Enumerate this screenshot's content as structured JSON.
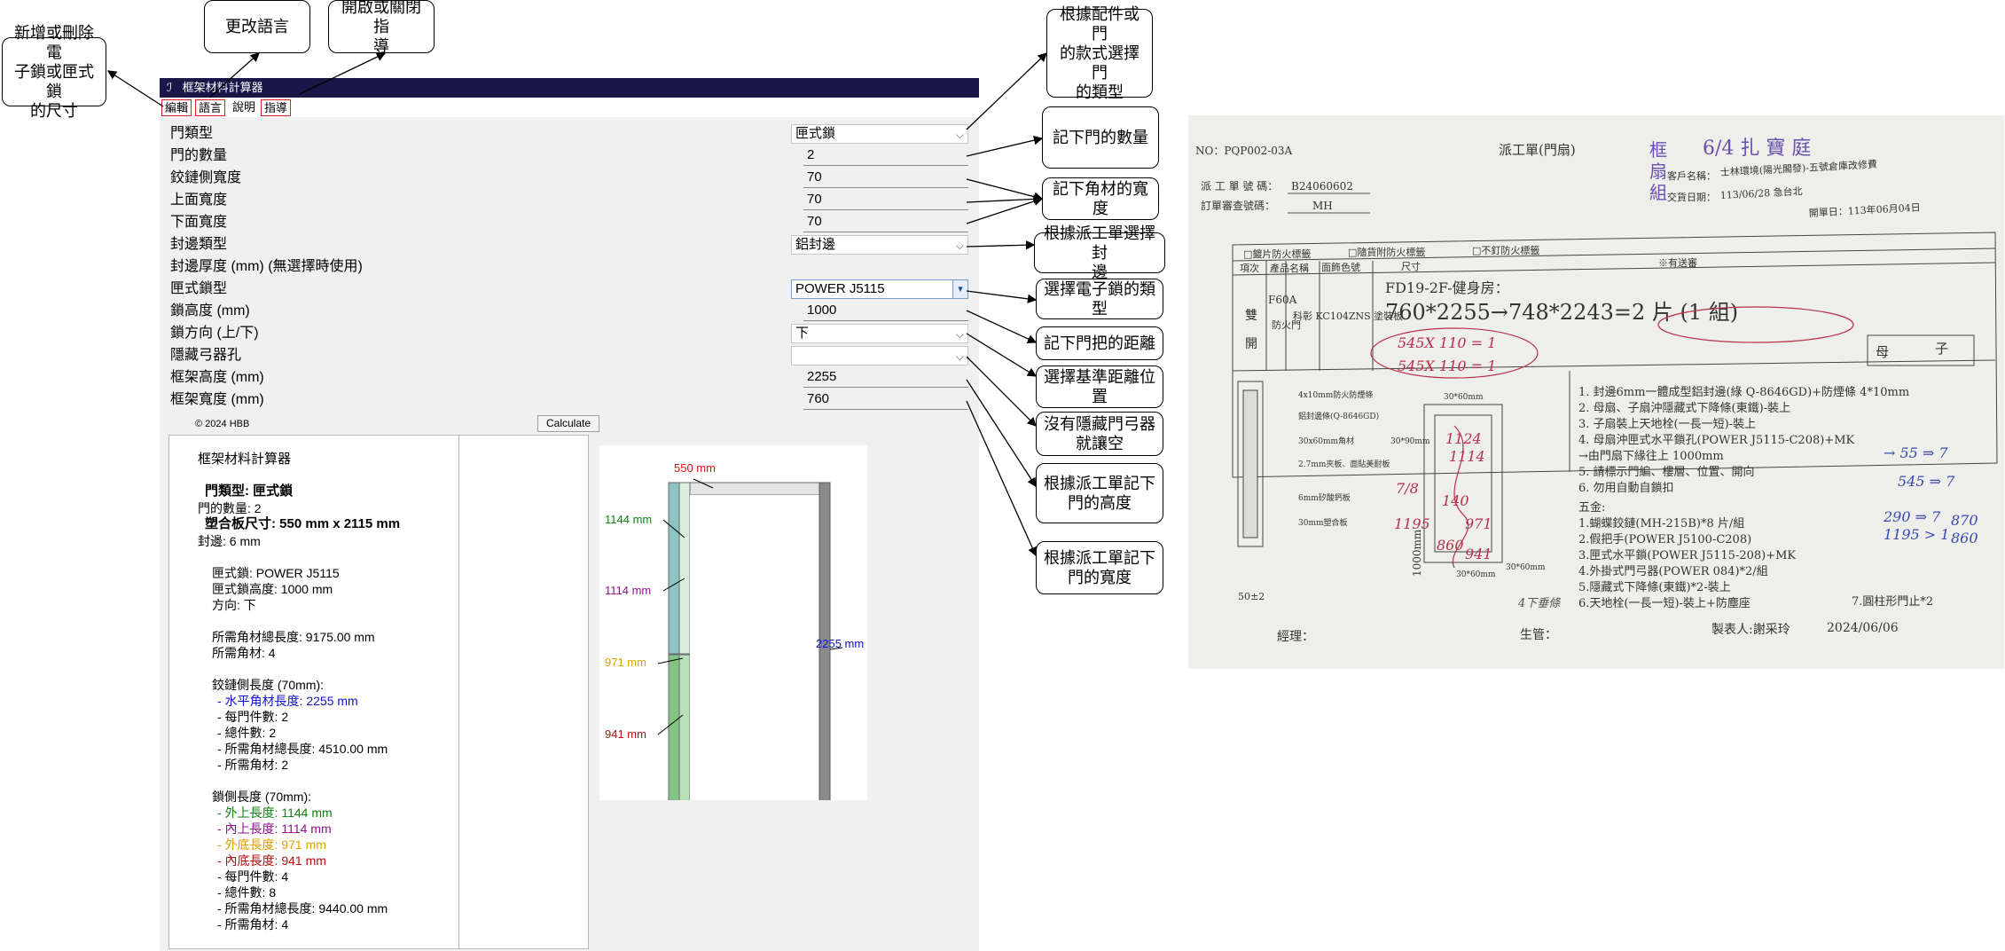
{
  "window": {
    "title": "框架材料計算器"
  },
  "menu": {
    "items": [
      "編輯",
      "語言",
      "說明",
      "指導"
    ]
  },
  "form": {
    "door_type_label": "門類型",
    "door_type_value": "匣式鎖",
    "door_count_label": "門的數量",
    "door_count_value": "2",
    "hinge_width_label": "鉸鏈側寬度",
    "hinge_width_value": "70",
    "top_width_label": "上面寬度",
    "top_width_value": "70",
    "bottom_width_label": "下面寬度",
    "bottom_width_value": "70",
    "edge_type_label": "封邊類型",
    "edge_type_value": "鋁封邊",
    "edge_thickness_label": "封邊厚度 (mm) (無選擇時使用)",
    "lock_type_label": "匣式鎖型",
    "lock_type_value": "POWER J5115",
    "lock_height_label": "鎖高度 (mm)",
    "lock_height_value": "1000",
    "lock_direction_label": "鎖方向 (上/下)",
    "lock_direction_value": "下",
    "hidden_closer_label": "隱藏弓器孔",
    "hidden_closer_value": "",
    "frame_height_label": "框架高度 (mm)",
    "frame_height_value": "2255",
    "frame_width_label": "框架寬度 (mm)",
    "frame_width_value": "760"
  },
  "footer": {
    "copyright": "© 2024 HBB",
    "calculate": "Calculate"
  },
  "result": {
    "title": "框架材料計算器",
    "door_type": "門類型: 匣式鎖",
    "door_count": "門的數量: 2",
    "board_size": "塑合板尺寸: 550 mm x 2115 mm",
    "edge": "封邊: 6 mm",
    "lock": "匣式鎖: POWER J5115",
    "lock_height": "匣式鎖高度: 1000 mm",
    "direction": "方向: 下",
    "total_length": "所需角材總長度: 9175.00 mm",
    "total_count": "所需角材: 4",
    "hinge_title": "鉸鏈側長度 (70mm):",
    "hinge_horizontal": "- 水平角材長度: 2255 mm",
    "hinge_per_door": "- 每門件數: 2",
    "hinge_total": "- 總件數: 2",
    "hinge_total_length": "- 所需角材總長度: 4510.00 mm",
    "hinge_needed": "- 所需角材: 2",
    "lock_title": "鎖側長度 (70mm):",
    "lock_outer_top": "- 外上長度: 1144 mm",
    "lock_inner_top": "- 內上長度: 1114 mm",
    "lock_outer_bottom": "- 外底長度: 971 mm",
    "lock_inner_bottom": "- 內底長度: 941 mm",
    "lock_per_door": "- 每門件數: 4",
    "lock_total": "- 總件數: 8",
    "lock_total_length": "- 所需角材總長度: 9440.00 mm",
    "lock_needed": "- 所需角材: 4"
  },
  "diagram": {
    "top": "550 mm",
    "outer_top": "1144 mm",
    "inner_top": "1114 mm",
    "outer_bottom": "971 mm",
    "inner_bottom": "941 mm",
    "height": "2255 mm",
    "colors": {
      "top": "#e01010",
      "outer_top": "#108010",
      "inner_top": "#901090",
      "outer_bottom": "#e0a000",
      "inner_bottom": "#b01010",
      "height": "#1010d0"
    }
  },
  "callouts": {
    "add_remove": "新增或刪除電\n子鎖或匣式鎖\n的尺寸",
    "change_language": "更改語言",
    "toggle_guide": "開啟或關閉指\n導",
    "door_type": "根據配件或門\n的款式選擇門\n的類型",
    "door_count": "記下門的數量",
    "frame_width": "記下角材的寬度",
    "edge_type": "根據派工單選擇封\n邊",
    "lock_type": "選擇電子鎖的類\n型",
    "handle_distance": "記下門把的距離",
    "reference": "選擇基準距離位\n置",
    "hidden_closer": "沒有隱藏門弓器\n就讓空",
    "height_note": "根據派工單記下\n門的高度",
    "width_note": "根據派工單記下\n門的寬度"
  },
  "work_order": {
    "no": "NO：PQP002-03A",
    "title": "派工單(門扇)",
    "dispatch_no_label": "派 工 單 號 碼：",
    "dispatch_no": "B24060602",
    "review_no_label": "訂單審查號碼：",
    "review_no": "MH",
    "customer_label": "客戶名稱：",
    "customer": "士林環境(陽光閣發)-五號倉庫改修費",
    "delivery_label": "交貨日期：",
    "delivery": "113/06/28 急台北",
    "issue_date": "開單日：113年06月04日",
    "check1": "□鍍片防火標籤",
    "check2": "□隨貨附防火標籤",
    "check3": "□不釘防火標籤",
    "col_item": "項次",
    "col_product": "產品名稱",
    "col_face": "面飾色號",
    "col_size": "尺寸",
    "col_note": "※有送審",
    "row_type1": "雙",
    "row_type2": "開",
    "row_code": "F60A",
    "row_fire": "防火門",
    "row_face": "科彰\nKC104ZNS\n塗裝板",
    "location": "FD19-2F-健身房：",
    "size_line": "760*2255→748*2243=2 片 (1 組)",
    "hw_mother": "母",
    "hw_son": "子",
    "layer1": "4x10mm防火防煙條",
    "layer2": "鋁封邊條(Q-8646GD)",
    "layer3": "30x60mm角材",
    "layer4": "2.7mm夾板、面貼美耐板",
    "layer5": "6mm矽酸鈣板",
    "layer6": "30mm塑合板",
    "dim_50": "50±2",
    "dim_30x60a": "30*60mm",
    "dim_30x90a": "30*90mm",
    "dim_1000": "1000mm",
    "dim_30x60b": "30*60mm",
    "dim_30x60c": "30*60mm",
    "note1": "1. 封邊6mm一體成型鋁封邊(綠 Q-8646GD)+防煙條 4*10mm",
    "note2": "2. 母扇、子扇沖隱藏式下降條(東鐵)-裝上",
    "note3": "3. 子扇裝上天地栓(一長一短)-裝上",
    "note4": "4. 母扇沖匣式水平鎖孔(POWER J5115-C208)+MK",
    "note5": "→由門扇下緣往上 1000mm",
    "note6": "5. 請標示門編、樓層、位置、開向",
    "note7": "6. 勿用自動自鎖扣",
    "hw_title": "五金:",
    "hw1": "1.蝴蝶鉸鏈(MH-215B)*8 片/組",
    "hw2": "2.假把手(POWER J5100-C208)",
    "hw3": "3.匣式水平鎖(POWER J5115-208)+MK",
    "hw4": "4.外掛式門弓器(POWER 084)*2/組",
    "hw5": "5.隱藏式下降條(東鐵)*2-裝上",
    "hw6": "6.天地栓(一長一短)-裝上+防塵座",
    "hw7": "7.圓柱形門止*2",
    "manager": "經理：",
    "production": "生管：",
    "maker": "製表人:謝采玲",
    "make_date": "2024/06/06",
    "stamp1": "框",
    "stamp2": "扇",
    "stamp3": "組",
    "hand_top": "6/4 扎 寶 庭",
    "hand_545a": "545X 110 = 1",
    "hand_545b": "545X 110 = 1",
    "hand_r1": "→ 55 ⇒ 7",
    "hand_r2": "545 ⇒ 7",
    "hand_r3": "290 ⇒ 7",
    "hand_r4": "1195 > 1",
    "hand_r5": "870",
    "hand_r6": "860",
    "hand_mid1": "1124",
    "hand_mid2": "1114",
    "hand_mid3": "140",
    "hand_mid4": "971",
    "hand_mid5": "860",
    "hand_mid6": "941",
    "hand_side1": "7/8",
    "hand_side2": "1195",
    "hand_bottom": "4下垂條"
  }
}
